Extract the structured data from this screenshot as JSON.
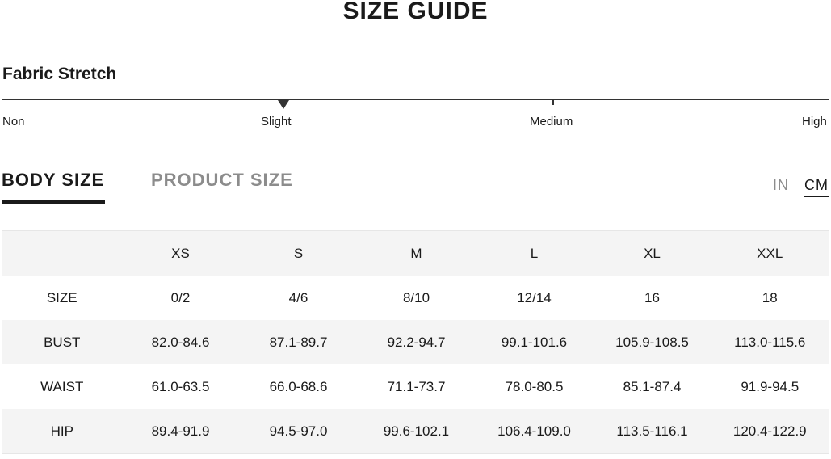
{
  "page": {
    "title": "SIZE GUIDE"
  },
  "fabric_stretch": {
    "label": "Fabric Stretch",
    "levels": [
      "Non",
      "Slight",
      "Medium",
      "High"
    ],
    "selected": "Slight"
  },
  "tabs": [
    {
      "label": "BODY SIZE",
      "active": true
    },
    {
      "label": "PRODUCT SIZE",
      "active": false
    }
  ],
  "units": [
    {
      "label": "IN",
      "active": false
    },
    {
      "label": "CM",
      "active": true
    }
  ],
  "table": {
    "columns": [
      "",
      "XS",
      "S",
      "M",
      "L",
      "XL",
      "XXL"
    ],
    "rows": [
      {
        "label": "SIZE",
        "values": [
          "0/2",
          "4/6",
          "8/10",
          "12/14",
          "16",
          "18"
        ]
      },
      {
        "label": "BUST",
        "values": [
          "82.0-84.6",
          "87.1-89.7",
          "92.2-94.7",
          "99.1-101.6",
          "105.9-108.5",
          "113.0-115.6"
        ]
      },
      {
        "label": "WAIST",
        "values": [
          "61.0-63.5",
          "66.0-68.6",
          "71.1-73.7",
          "78.0-80.5",
          "85.1-87.4",
          "91.9-94.5"
        ]
      },
      {
        "label": "HIP",
        "values": [
          "89.4-91.9",
          "94.5-97.0",
          "99.6-102.1",
          "106.4-109.0",
          "113.5-116.1",
          "120.4-122.9"
        ]
      }
    ]
  },
  "colors": {
    "text": "#1a1a1a",
    "inactive": "#8c8c8c",
    "row_shade": "#f4f4f4"
  },
  "icons": {
    "stretch_pointer": "triangle-down-icon"
  }
}
